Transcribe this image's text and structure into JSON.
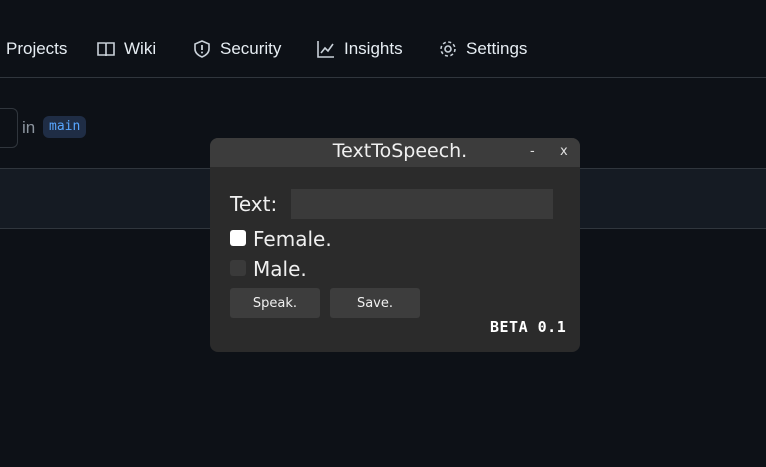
{
  "nav": {
    "items": [
      {
        "label": "Projects",
        "icon": "projects-icon"
      },
      {
        "label": "Wiki",
        "icon": "book-icon"
      },
      {
        "label": "Security",
        "icon": "shield-icon"
      },
      {
        "label": "Insights",
        "icon": "graph-icon"
      },
      {
        "label": "Settings",
        "icon": "gear-icon"
      }
    ]
  },
  "branch": {
    "in_label": "in",
    "name": "main"
  },
  "dialog": {
    "title": "TextToSpeech.",
    "minimize": "-",
    "close": "x",
    "text_label": "Text:",
    "text_value": "",
    "female_label": "Female.",
    "female_checked": true,
    "male_label": "Male.",
    "male_checked": false,
    "speak_label": "Speak.",
    "save_label": "Save.",
    "version": "BETA 0.1"
  },
  "colors": {
    "page_bg": "#0d1117",
    "dialog_bg": "#2b2b2b",
    "titlebar_bg": "#3c3c3c",
    "branch_fg": "#58a6ff"
  }
}
